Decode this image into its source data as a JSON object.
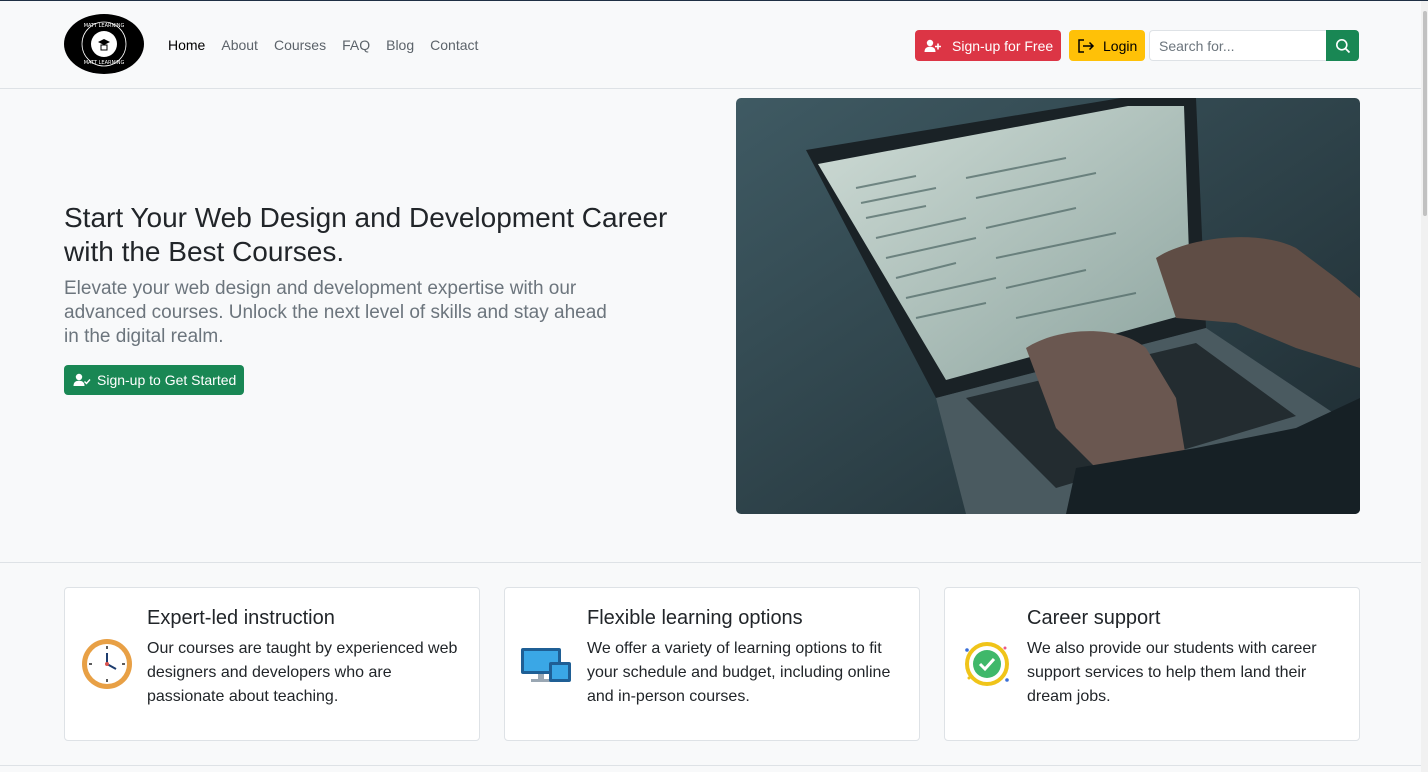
{
  "brand": {
    "logo_text": "MATT LEARNING"
  },
  "nav": {
    "links": [
      {
        "label": "Home"
      },
      {
        "label": "About"
      },
      {
        "label": "Courses"
      },
      {
        "label": "FAQ"
      },
      {
        "label": "Blog"
      },
      {
        "label": "Contact"
      }
    ],
    "signup_label": "Sign-up for Free",
    "login_label": "Login",
    "search_placeholder": "Search for..."
  },
  "hero": {
    "title": "Start Your Web Design and Development Career with the Best Courses.",
    "lead": "Elevate your web design and development expertise with our advanced courses. Unlock the next level of skills and stay ahead in the digital realm.",
    "cta_label": "Sign-up to Get Started"
  },
  "features": [
    {
      "title": "Expert-led instruction",
      "text": "Our courses are taught by experienced web designers and developers who are passionate about teaching.",
      "icon": "clock-icon"
    },
    {
      "title": "Flexible learning options",
      "text": "We offer a variety of learning options to fit your schedule and budget, including online and in-person courses.",
      "icon": "devices-icon"
    },
    {
      "title": "Career support",
      "text": "We also provide our students with career support services to help them land their dream jobs.",
      "icon": "checkmark-badge-icon"
    }
  ],
  "colors": {
    "danger": "#dc3545",
    "warning": "#ffc107",
    "success": "#198754",
    "background": "#f8f9fa"
  }
}
